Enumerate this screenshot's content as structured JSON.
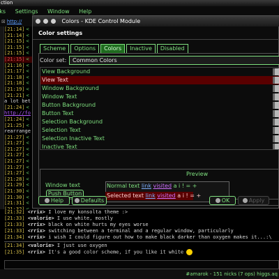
{
  "background": {
    "titlebar_text": "ction",
    "menu": [
      "rks",
      "Settings",
      "Window",
      "Help"
    ],
    "toolbar_url": "http://",
    "log_lines": [
      {
        "text": "[21:14]",
        "chan": "<",
        "style": "normal"
      },
      {
        "text": "[21:14]",
        "chan": "<",
        "style": "normal"
      },
      {
        "text": "[21:15]",
        "chan": "<",
        "style": "normal"
      },
      {
        "text": "[21:15]",
        "chan": "<",
        "style": "normal"
      },
      {
        "text": "[21:15]",
        "chan": "<",
        "style": "normal"
      },
      {
        "text": "[21:15]",
        "chan": "<",
        "style": "red"
      },
      {
        "text": "[21:16]",
        "chan": "<",
        "style": "normal"
      },
      {
        "text": "[21:17]",
        "chan": "<",
        "style": "normal"
      },
      {
        "text": "[21:18]",
        "chan": "<",
        "style": "normal"
      },
      {
        "text": "[21:18]",
        "chan": "<",
        "style": "normal"
      },
      {
        "text": "[21:19]",
        "chan": "<",
        "style": "normal"
      },
      {
        "text": "[21:21]",
        "chan": "<",
        "style": "normal"
      },
      {
        "text": "a lot bet",
        "chan": "",
        "style": "plain"
      },
      {
        "text": "[21:24]",
        "chan": "<",
        "style": "normal"
      },
      {
        "text": "http://fo",
        "chan": "",
        "style": "link"
      },
      {
        "text": "[21:24]",
        "chan": "<",
        "style": "normal"
      },
      {
        "text": "[21:25]",
        "chan": "<",
        "style": "normal"
      },
      {
        "text": "rearrange",
        "chan": "",
        "style": "plain"
      },
      {
        "text": "[21:27]",
        "chan": "<",
        "style": "normal"
      },
      {
        "text": "[21:27]",
        "chan": "<",
        "style": "normal"
      },
      {
        "text": "[21:27]",
        "chan": "<",
        "style": "normal"
      },
      {
        "text": "[21:27]",
        "chan": "<",
        "style": "normal"
      },
      {
        "text": "[21:27]",
        "chan": "<",
        "style": "normal"
      },
      {
        "text": "[21:27]",
        "chan": "<",
        "style": "normal"
      },
      {
        "text": "[21:27]",
        "chan": "<",
        "style": "normal"
      },
      {
        "text": "[21:28]",
        "chan": "<",
        "style": "normal"
      },
      {
        "text": "[21:29]",
        "chan": "<",
        "style": "normal"
      },
      {
        "text": "[21:30]",
        "chan": "<",
        "style": "normal"
      },
      {
        "text": "[21:30]",
        "chan": "<",
        "style": "normal"
      },
      {
        "text": "[21:31]",
        "chan": "<",
        "style": "normal"
      },
      {
        "text": "[21:32]",
        "chan": "<",
        "style": "normal"
      }
    ],
    "chat_lines": [
      {
        "time": "[21:32]",
        "nick": "<rrix>",
        "msg": "I love my konsolta theme :>"
      },
      {
        "time": "[21:33]",
        "nick": "<valorie>",
        "msg": "I use white, mostly"
      },
      {
        "time": "[21:33]",
        "nick": "<rrix>",
        "msg": "black on white hurts my eyes worse"
      },
      {
        "time": "[21:33]",
        "nick": "<rrix>",
        "msg": "switching between a terminal and a regular window, particularly"
      },
      {
        "time": "[21:34]",
        "nick": "<rrix>",
        "msg": "i wish I could figure out how to make black darker than oxygen makes it...:\\"
      },
      {
        "time": "[21:34]",
        "nick": "<valorie>",
        "msg": "I just use oxygen"
      },
      {
        "time": "[21:35]",
        "nick": "<rrix>",
        "msg": "It's a good color scheme, if you like it white"
      }
    ],
    "status_text": "#amarok - 151 nicks (7 ops) higgs.aq"
  },
  "dialog": {
    "title": "Colors - KDE Control Module",
    "header": "Color settings",
    "tabs": [
      {
        "label": "Scheme",
        "active": false
      },
      {
        "label": "Options",
        "active": false
      },
      {
        "label": "Colors",
        "active": true
      },
      {
        "label": "Inactive",
        "active": false
      },
      {
        "label": "Disabled",
        "active": false
      }
    ],
    "color_set_label": "Color set:",
    "color_set_value": "Common Colors",
    "color_roles": [
      {
        "label": "View Background",
        "selected": false
      },
      {
        "label": "View Text",
        "selected": true
      },
      {
        "label": "Window Background",
        "selected": false
      },
      {
        "label": "Window Text",
        "selected": false
      },
      {
        "label": "Button Background",
        "selected": false
      },
      {
        "label": "Button Text",
        "selected": false
      },
      {
        "label": "Selection Background",
        "selected": false
      },
      {
        "label": "Selection Text",
        "selected": false
      },
      {
        "label": "Selection Inactive Text",
        "selected": false
      },
      {
        "label": "Inactive Text",
        "selected": false
      }
    ],
    "preview": {
      "label": "Preview",
      "window_text": "Window text",
      "push_button": "Push Button",
      "normal_text": "Normal text",
      "link": "link",
      "visited": "visited",
      "symbols": "a i ! = +",
      "selected_text": "Selected text"
    },
    "buttons": {
      "help": "Help",
      "defaults": "Defaults",
      "ok": "OK",
      "apply": "Apply"
    }
  }
}
